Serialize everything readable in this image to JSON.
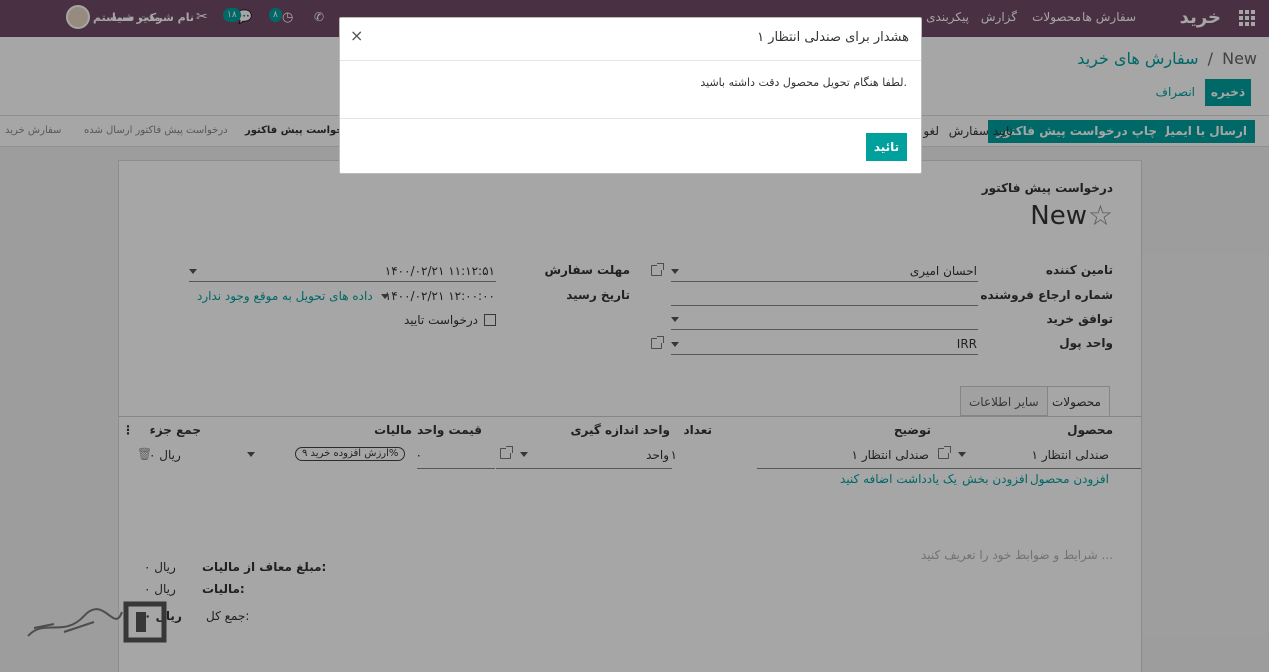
{
  "nav": {
    "app_title": "خرید",
    "menu": [
      "سفارش ها",
      "محصولات",
      "گزارش",
      "پیکربندی"
    ],
    "company": "نام شرکت شما",
    "user": "مدیر سیستم",
    "messages_count": "۱۸",
    "activities_count": "۸"
  },
  "breadcrumb": {
    "parent": "سفارش های خرید",
    "separator": "/",
    "current": "New"
  },
  "actions": {
    "save": "ذخیره",
    "discard": "انصراف"
  },
  "statusbar": {
    "buttons": [
      "ارسال با ایمیل",
      "چاپ درخواست پیش فاکتور",
      "تایید سفارش",
      "لغو"
    ],
    "stages": [
      "درخواست پیش فاکتور",
      "درخواست پیش فاکتور ارسال شده",
      "سفارش خرید"
    ]
  },
  "form": {
    "doc_type": "درخواست پیش فاکتور",
    "name": "New",
    "fields": {
      "vendor_label": "تامین کننده",
      "vendor_value": "احسان امیری",
      "vendor_ref_label": "شماره ارجاع فروشنده",
      "agreement_label": "توافق خرید",
      "currency_label": "واحد پول",
      "currency_value": "IRR",
      "deadline_label": "مهلت سفارش",
      "deadline_value": "۱۴۰۰/۰۲/۲۱ ۱۱:۱۲:۵۱",
      "receipt_label": "تاریخ رسید",
      "receipt_value": "۱۴۰۰/۰۲/۲۱ ۱۲:۰۰:۰۰",
      "receipt_warning": "داده های تحویل به موقع وجود ندارد",
      "ask_confirm_label": "درخواست تایید"
    },
    "tabs": [
      "محصولات",
      "سایر اطلاعات"
    ],
    "table": {
      "headers": [
        "محصول",
        "توضیح",
        "تعداد",
        "واحد اندازه گیری",
        "قیمت واحد",
        "مالیات",
        "جمع جزء"
      ],
      "row": {
        "product": "صندلی انتظار ۱",
        "description": "صندلی انتظار ۱",
        "qty": "۱",
        "uom": "واحد",
        "price": "۰",
        "tax": "ارزش افزوده خرید ۹%",
        "subtotal": "۰ ریال"
      },
      "add_product": "افزودن محصول",
      "add_section": "افزودن بخش",
      "add_note": "یک یادداشت اضافه کنید"
    },
    "terms_placeholder": "شرایط و ضوابط خود را تعریف کنید ...",
    "totals": {
      "untaxed_label": "مبلغ معاف از مالیات:",
      "untaxed_value": "۰ ریال",
      "tax_label": "مالیات:",
      "tax_value": "۰ ریال",
      "total_label": "جمع کل:",
      "total_value": "۰ ریال"
    }
  },
  "modal": {
    "title": "هشدار برای صندلی انتظار ۱",
    "body": "لطفا هنگام تحویل محصول دقت داشته باشید.",
    "ok": "تائید"
  },
  "colors": {
    "brand": "#714b67",
    "accent": "#00a09d"
  }
}
